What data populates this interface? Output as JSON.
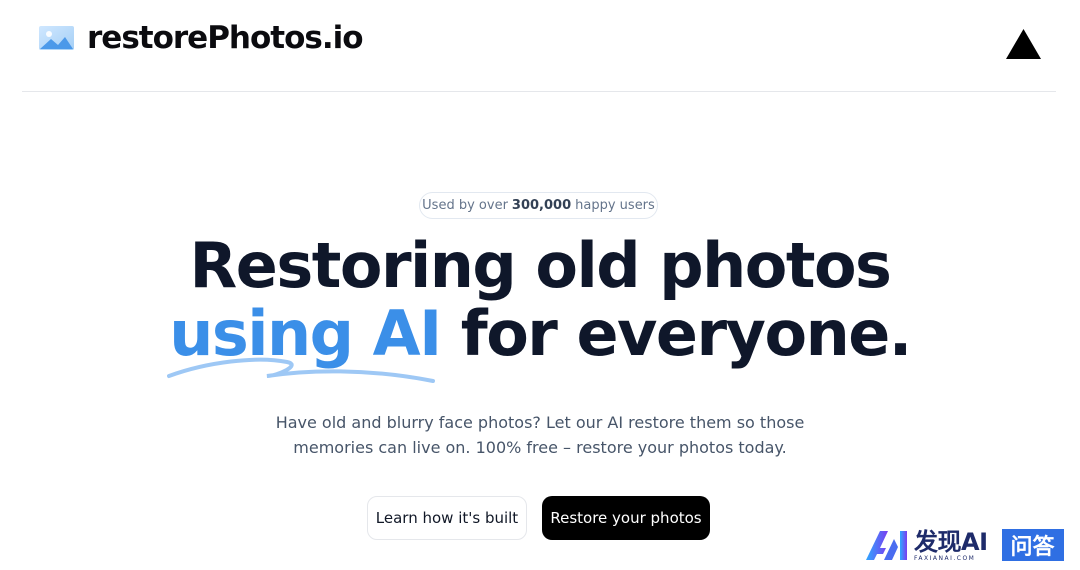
{
  "header": {
    "brand_name": "restorePhotos.io",
    "logo_icon": "photo-icon",
    "vercel_icon": "vercel-triangle-icon"
  },
  "hero": {
    "badge": {
      "prefix": "Used by over",
      "count": "300,000",
      "suffix": "happy users"
    },
    "headline_line1": "Restoring old photos",
    "headline_accent": "using AI",
    "headline_rest": "for everyone.",
    "subtitle": "Have old and blurry face photos? Let our AI restore them so those memories can live on. 100% free – restore your photos today.",
    "learn_button": "Learn how it's built",
    "restore_button": "Restore your photos"
  },
  "watermark": {
    "name": "发现AI",
    "domain": "FAXIANAI.COM",
    "qa": "问答"
  },
  "colors": {
    "accent": "#3b8fe8",
    "text_dark": "#0f172a",
    "primary_button": "#000000"
  }
}
